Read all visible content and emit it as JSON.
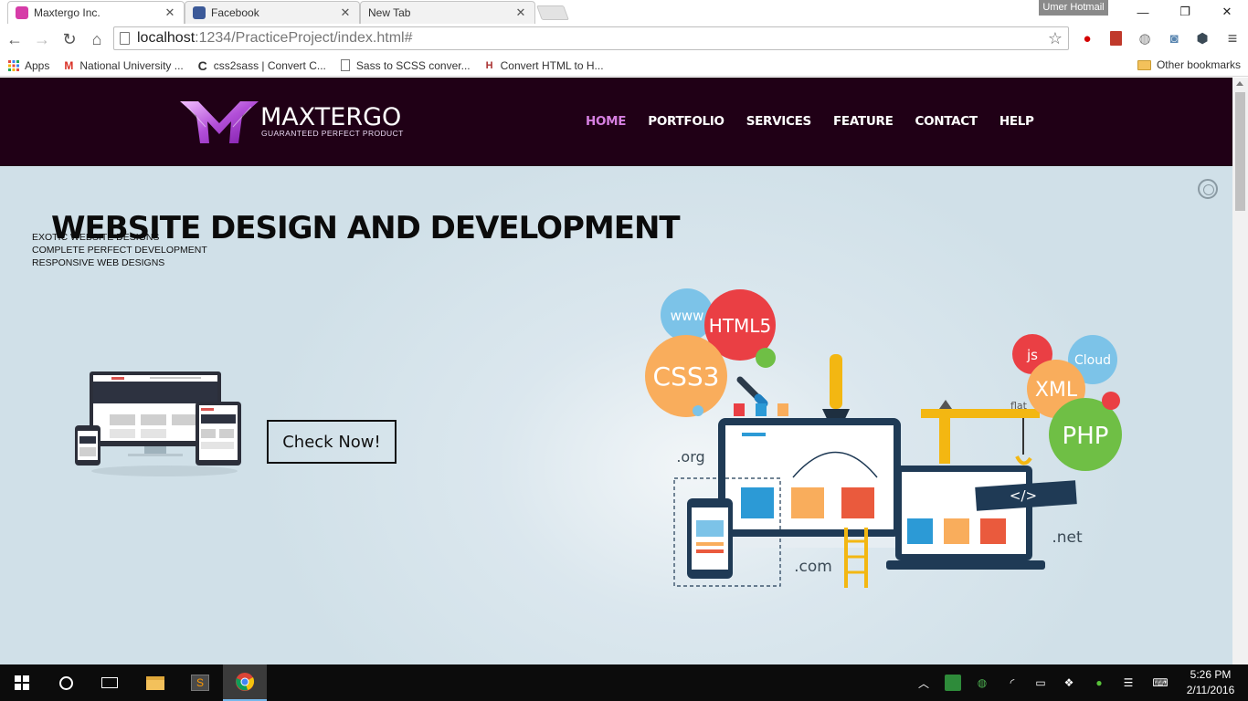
{
  "browser": {
    "tabs": [
      {
        "title": "Maxtergo Inc.",
        "favicon_color": "#d63ca8",
        "active": true
      },
      {
        "title": "Facebook",
        "favicon_color": "#3b5998",
        "active": false
      },
      {
        "title": "New Tab",
        "favicon_color": "",
        "active": false
      }
    ],
    "profile_name": "Umer Hotmail",
    "url_host": "localhost",
    "url_path": ":1234/PracticeProject/index.html#",
    "bookmarks": [
      {
        "label": "Apps",
        "icon": "apps-grid-icon"
      },
      {
        "label": "National University ...",
        "icon": "gmail-icon"
      },
      {
        "label": "css2sass | Convert C...",
        "icon": "c-logo-icon"
      },
      {
        "label": "Sass to SCSS conver...",
        "icon": "page-icon"
      },
      {
        "label": "Convert HTML to H...",
        "icon": "haml-icon"
      }
    ],
    "other_bookmarks": "Other bookmarks"
  },
  "site": {
    "brand_name": "MAXTERGO",
    "brand_tagline": "GUARANTEED PERFECT PRODUCT",
    "nav": [
      {
        "label": "HOME",
        "active": true
      },
      {
        "label": "PORTFOLIO",
        "active": false
      },
      {
        "label": "SERVICES",
        "active": false
      },
      {
        "label": "FEATURE",
        "active": false
      },
      {
        "label": "CONTACT",
        "active": false
      },
      {
        "label": "HELP",
        "active": false
      }
    ],
    "hero": {
      "title": "WEBSITE DESIGN AND DEVELOPMENT",
      "lines": [
        "EXOTIC WEBSITE DESIGNS",
        "COMPLETE PERFECT DEVELOPMENT",
        "RESPONSIVE WEB DESIGNS"
      ],
      "cta": "Check Now!",
      "illustration_labels": {
        "www": "www",
        "html5": "HTML5",
        "css3": "CSS3",
        "js": "js",
        "cloud": "Cloud",
        "xml": "XML",
        "flat": "flat",
        "php": "PHP",
        "org": ".org",
        "com": ".com",
        "net": ".net",
        "code": "</>"
      }
    }
  },
  "taskbar": {
    "time": "5:26 PM",
    "date": "2/11/2016"
  },
  "colors": {
    "header_bg": "#200016",
    "nav_active": "#d67fe0",
    "hero_bg": "#d2e2ea"
  }
}
